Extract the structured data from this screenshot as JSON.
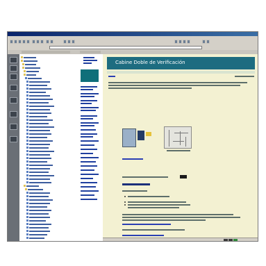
{
  "window": {
    "title": ""
  },
  "content": {
    "banner_title": "Cabine Doble de Verificación"
  },
  "colors": {
    "banner": "#1d6c80",
    "content_background": "#f3f1d2",
    "link": "#2b3fb3",
    "window_chrome": "#d4d0c8",
    "title_bar": "#0a246a"
  },
  "icons": {
    "tree_folder": "folder-icon",
    "tree_page": "page-icon"
  }
}
